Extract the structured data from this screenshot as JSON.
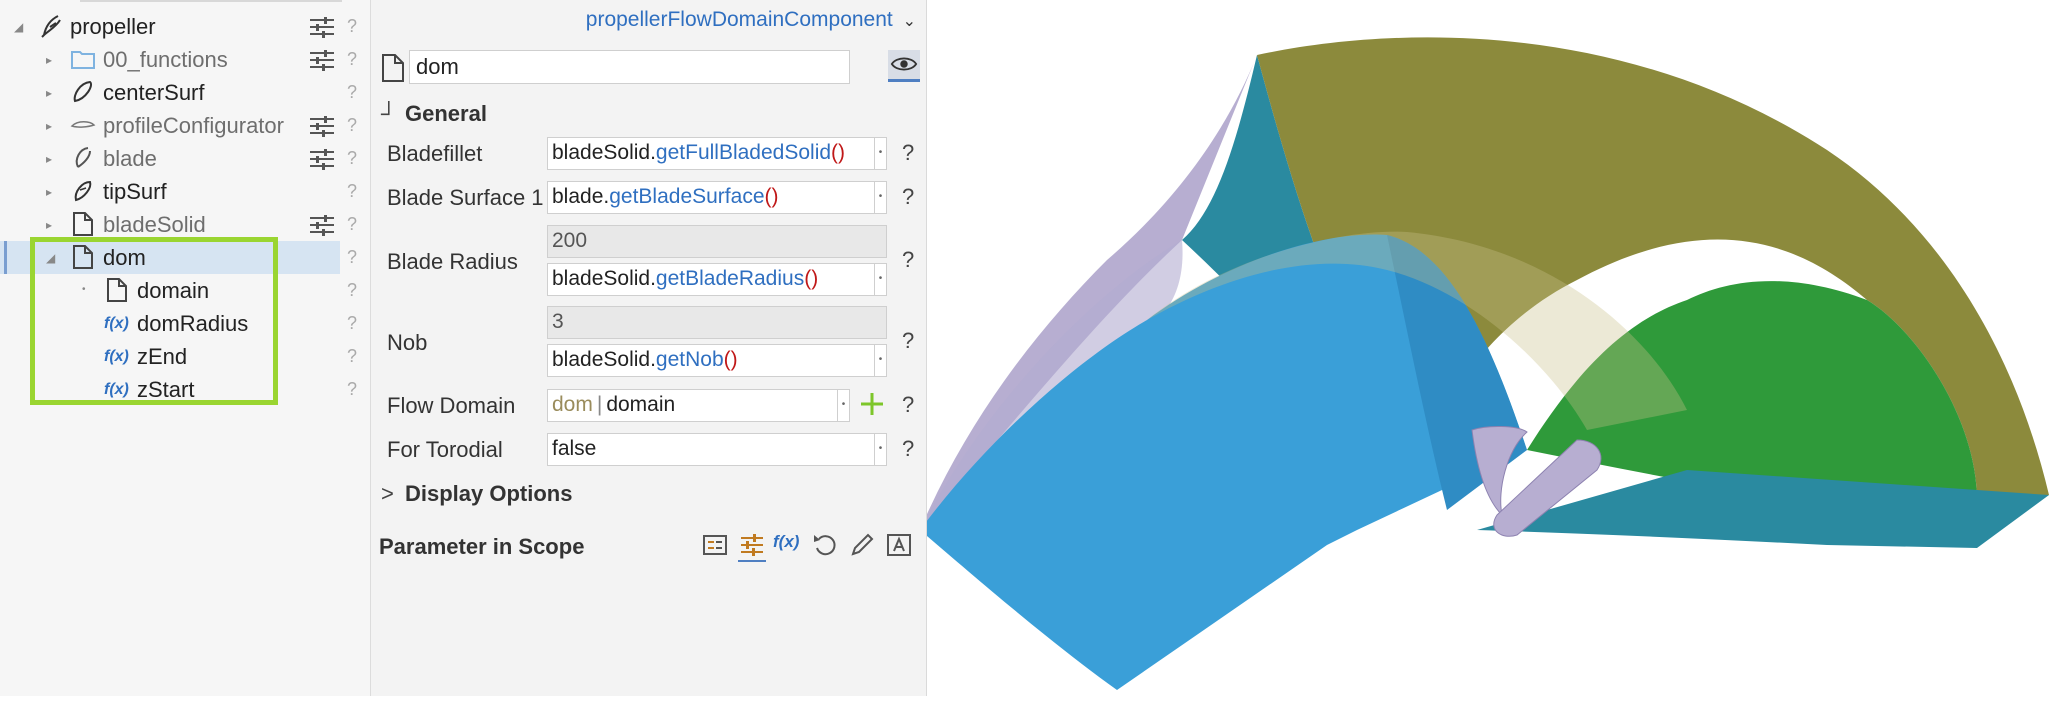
{
  "tree": {
    "items": [
      {
        "label": "propeller",
        "icon": "propeller-icon"
      },
      {
        "label": "00_functions",
        "icon": "folder-icon"
      },
      {
        "label": "centerSurf",
        "icon": "surface-icon"
      },
      {
        "label": "profileConfigurator",
        "icon": "profile-icon"
      },
      {
        "label": "blade",
        "icon": "blade-icon"
      },
      {
        "label": "tipSurf",
        "icon": "tip-surface-icon"
      },
      {
        "label": "bladeSolid",
        "icon": "document-icon"
      },
      {
        "label": "dom",
        "icon": "document-icon"
      },
      {
        "label": "domain",
        "icon": "document-icon"
      },
      {
        "label": "domRadius",
        "icon": "function-icon"
      },
      {
        "label": "zEnd",
        "icon": "function-icon"
      },
      {
        "label": "zStart",
        "icon": "function-icon"
      }
    ],
    "fx_label": "f(x)",
    "help_mark": "?"
  },
  "panel": {
    "component_type": "propellerFlowDomainComponent",
    "name_value": "dom",
    "general": {
      "section_label": "General",
      "params": {
        "bladefillet": {
          "label": "Bladefillet",
          "obj": "bladeSolid.",
          "method": "getFullBladedSolid",
          "parens": "()"
        },
        "blade_surface_1": {
          "label": "Blade Surface 1",
          "obj": "blade.",
          "method": "getBladeSurface",
          "parens": "()"
        },
        "blade_radius": {
          "label": "Blade Radius",
          "value": "200",
          "obj": "bladeSolid.",
          "method": "getBladeRadius",
          "parens": "()"
        },
        "nob": {
          "label": "Nob",
          "value": "3",
          "obj": "bladeSolid.",
          "method": "getNob",
          "parens": "()"
        },
        "flow_domain": {
          "label": "Flow Domain",
          "scope": "dom",
          "sep": "|",
          "value": "domain"
        },
        "for_torodial": {
          "label": "For Torodial",
          "value": "false"
        }
      }
    },
    "display_options_label": "Display Options",
    "parameter_in_scope_label": "Parameter in Scope",
    "toolbar_fx": "f(x)",
    "help_mark": "?"
  },
  "viewport": {
    "colors": {
      "domain_blue": "#3a9fd8",
      "domain_olive": "#8c8a3c",
      "domain_green": "#2f9a3a",
      "domain_teal": "#2a8aa0",
      "blade_lavender": "#b7aed1"
    }
  },
  "colors": {
    "accent_blue": "#2f6fc0",
    "highlight_green": "#9ad531",
    "selection_bg": "#d6e4f2",
    "error_red": "#c01818"
  }
}
